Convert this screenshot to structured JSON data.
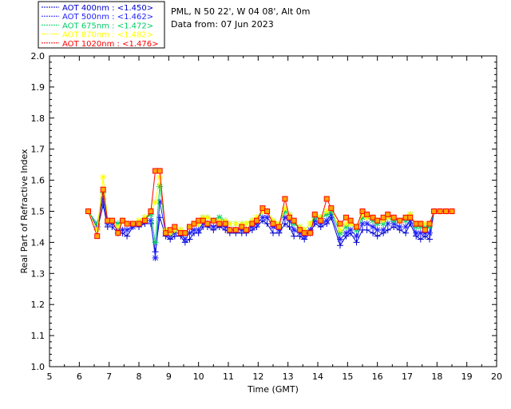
{
  "header": {
    "site_line": "PML, N 50 22', W 04 08', Alt 0m",
    "date_line": "Data from: 07 Jun 2023"
  },
  "chart_data": {
    "type": "line",
    "xlabel": "Time (GMT)",
    "ylabel": "Real Part of Refractive Index",
    "xlim": [
      5,
      20
    ],
    "ylim": [
      1.0,
      2.0
    ],
    "xticks": [
      "5",
      "6",
      "7",
      "8",
      "9",
      "10",
      "11",
      "12",
      "13",
      "14",
      "15",
      "16",
      "17",
      "18",
      "19",
      "20"
    ],
    "yticks": [
      "1.0",
      "1.1",
      "1.2",
      "1.3",
      "1.4",
      "1.5",
      "1.6",
      "1.7",
      "1.8",
      "1.9",
      "2.0"
    ],
    "legend_position": "top-left",
    "grid": false,
    "series": [
      {
        "name": "AOT  400nm : <1.450>",
        "color": "#0000cc",
        "marker": "plus",
        "x": [
          6.3,
          6.6,
          6.8,
          6.95,
          7.1,
          7.3,
          7.45,
          7.6,
          7.8,
          8.0,
          8.2,
          8.4,
          8.55,
          8.7,
          8.9,
          9.05,
          9.2,
          9.4,
          9.55,
          9.7,
          9.85,
          10.0,
          10.15,
          10.3,
          10.5,
          10.7,
          10.9,
          11.05,
          11.25,
          11.45,
          11.6,
          11.8,
          11.95,
          12.15,
          12.3,
          12.5,
          12.7,
          12.9,
          13.05,
          13.2,
          13.4,
          13.55,
          13.75,
          13.9,
          14.1,
          14.3,
          14.45,
          14.75,
          14.95,
          15.1,
          15.3,
          15.5,
          15.65,
          15.85,
          16.0,
          16.2,
          16.35,
          16.55,
          16.75,
          16.95,
          17.1,
          17.3,
          17.45,
          17.6,
          17.75,
          17.9,
          18.1,
          18.3,
          18.5
        ],
        "y": [
          1.5,
          1.44,
          1.52,
          1.45,
          1.45,
          1.43,
          1.43,
          1.42,
          1.45,
          1.45,
          1.46,
          1.46,
          1.37,
          1.48,
          1.42,
          1.41,
          1.42,
          1.42,
          1.4,
          1.41,
          1.43,
          1.43,
          1.45,
          1.45,
          1.44,
          1.45,
          1.44,
          1.43,
          1.43,
          1.43,
          1.43,
          1.44,
          1.45,
          1.47,
          1.46,
          1.43,
          1.43,
          1.46,
          1.45,
          1.42,
          1.42,
          1.41,
          1.43,
          1.46,
          1.45,
          1.46,
          1.48,
          1.39,
          1.42,
          1.43,
          1.4,
          1.44,
          1.44,
          1.43,
          1.42,
          1.43,
          1.44,
          1.45,
          1.44,
          1.43,
          1.46,
          1.42,
          1.41,
          1.42,
          1.41,
          1.5,
          1.5,
          1.5,
          1.5
        ]
      },
      {
        "name": "AOT  500nm : <1.462>",
        "color": "#2222ff",
        "marker": "asterisk",
        "x": [
          6.3,
          6.6,
          6.8,
          6.95,
          7.1,
          7.3,
          7.45,
          7.6,
          7.8,
          8.0,
          8.2,
          8.4,
          8.55,
          8.7,
          8.9,
          9.05,
          9.2,
          9.4,
          9.55,
          9.7,
          9.85,
          10.0,
          10.15,
          10.3,
          10.5,
          10.7,
          10.9,
          11.05,
          11.25,
          11.45,
          11.6,
          11.8,
          11.95,
          12.15,
          12.3,
          12.5,
          12.7,
          12.9,
          13.05,
          13.2,
          13.4,
          13.55,
          13.75,
          13.9,
          14.1,
          14.3,
          14.45,
          14.75,
          14.95,
          15.1,
          15.3,
          15.5,
          15.65,
          15.85,
          16.0,
          16.2,
          16.35,
          16.55,
          16.75,
          16.95,
          17.1,
          17.3,
          17.45,
          17.6,
          17.75,
          17.9,
          18.1,
          18.3,
          18.5
        ],
        "y": [
          1.5,
          1.45,
          1.54,
          1.46,
          1.46,
          1.44,
          1.44,
          1.44,
          1.45,
          1.46,
          1.47,
          1.47,
          1.35,
          1.53,
          1.43,
          1.42,
          1.43,
          1.43,
          1.41,
          1.43,
          1.44,
          1.44,
          1.46,
          1.46,
          1.45,
          1.46,
          1.45,
          1.44,
          1.44,
          1.44,
          1.44,
          1.45,
          1.46,
          1.48,
          1.48,
          1.45,
          1.44,
          1.48,
          1.47,
          1.44,
          1.43,
          1.42,
          1.44,
          1.47,
          1.46,
          1.47,
          1.49,
          1.41,
          1.43,
          1.44,
          1.42,
          1.46,
          1.46,
          1.45,
          1.44,
          1.44,
          1.46,
          1.46,
          1.45,
          1.45,
          1.47,
          1.43,
          1.43,
          1.43,
          1.43,
          1.5,
          1.5,
          1.5,
          1.5
        ]
      },
      {
        "name": "AOT  675nm : <1.472>",
        "color": "#00cc66",
        "marker": "asterisk",
        "x": [
          6.3,
          6.6,
          6.8,
          6.95,
          7.1,
          7.3,
          7.45,
          7.6,
          7.8,
          8.0,
          8.2,
          8.4,
          8.55,
          8.7,
          8.9,
          9.05,
          9.2,
          9.4,
          9.55,
          9.7,
          9.85,
          10.0,
          10.15,
          10.3,
          10.5,
          10.7,
          10.9,
          11.05,
          11.25,
          11.45,
          11.6,
          11.8,
          11.95,
          12.15,
          12.3,
          12.5,
          12.7,
          12.9,
          13.05,
          13.2,
          13.4,
          13.55,
          13.75,
          13.9,
          14.1,
          14.3,
          14.45,
          14.75,
          14.95,
          15.1,
          15.3,
          15.5,
          15.65,
          15.85,
          16.0,
          16.2,
          16.35,
          16.55,
          16.75,
          16.95,
          17.1,
          17.3,
          17.45,
          17.6,
          17.75,
          17.9,
          18.1,
          18.3,
          18.5
        ],
        "y": [
          1.5,
          1.46,
          1.56,
          1.47,
          1.47,
          1.46,
          1.47,
          1.46,
          1.46,
          1.47,
          1.48,
          1.49,
          1.4,
          1.58,
          1.44,
          1.43,
          1.44,
          1.44,
          1.43,
          1.45,
          1.46,
          1.46,
          1.48,
          1.48,
          1.47,
          1.48,
          1.47,
          1.46,
          1.46,
          1.46,
          1.46,
          1.47,
          1.47,
          1.5,
          1.5,
          1.47,
          1.46,
          1.5,
          1.49,
          1.46,
          1.45,
          1.44,
          1.46,
          1.48,
          1.48,
          1.49,
          1.5,
          1.43,
          1.45,
          1.46,
          1.44,
          1.48,
          1.48,
          1.47,
          1.46,
          1.46,
          1.48,
          1.47,
          1.47,
          1.47,
          1.49,
          1.45,
          1.45,
          1.45,
          1.45,
          1.5,
          1.5,
          1.5,
          1.5
        ]
      },
      {
        "name": "AOT  870nm : <1.482>",
        "color": "#ffff00",
        "marker": "asterisk",
        "x": [
          6.3,
          6.6,
          6.8,
          6.95,
          7.1,
          7.3,
          7.45,
          7.6,
          7.8,
          8.0,
          8.2,
          8.4,
          8.55,
          8.7,
          8.9,
          9.05,
          9.2,
          9.4,
          9.55,
          9.7,
          9.85,
          10.0,
          10.15,
          10.3,
          10.5,
          10.7,
          10.9,
          11.05,
          11.25,
          11.45,
          11.6,
          11.8,
          11.95,
          12.15,
          12.3,
          12.5,
          12.7,
          12.9,
          13.05,
          13.2,
          13.4,
          13.55,
          13.75,
          13.9,
          14.1,
          14.3,
          14.45,
          14.75,
          14.95,
          15.1,
          15.3,
          15.5,
          15.65,
          15.85,
          16.0,
          16.2,
          16.35,
          16.55,
          16.75,
          16.95,
          17.1,
          17.3,
          17.45,
          17.6,
          17.75,
          17.9,
          18.1,
          18.3,
          18.5
        ],
        "y": [
          1.5,
          1.44,
          1.61,
          1.47,
          1.47,
          1.45,
          1.47,
          1.46,
          1.46,
          1.47,
          1.48,
          1.5,
          1.53,
          1.61,
          1.44,
          1.43,
          1.44,
          1.44,
          1.43,
          1.45,
          1.46,
          1.46,
          1.48,
          1.48,
          1.47,
          1.47,
          1.47,
          1.46,
          1.46,
          1.46,
          1.46,
          1.47,
          1.48,
          1.5,
          1.5,
          1.47,
          1.46,
          1.51,
          1.49,
          1.47,
          1.45,
          1.44,
          1.46,
          1.49,
          1.48,
          1.5,
          1.51,
          1.44,
          1.46,
          1.46,
          1.45,
          1.49,
          1.48,
          1.48,
          1.47,
          1.47,
          1.48,
          1.48,
          1.47,
          1.48,
          1.49,
          1.46,
          1.46,
          1.46,
          1.46,
          1.5,
          1.5,
          1.5,
          1.5
        ]
      },
      {
        "name": "AOT 1020nm : <1.476>",
        "color": "#ff0000",
        "marker": "square",
        "x": [
          6.3,
          6.6,
          6.8,
          6.95,
          7.1,
          7.3,
          7.45,
          7.6,
          7.8,
          8.0,
          8.2,
          8.4,
          8.55,
          8.7,
          8.9,
          9.05,
          9.2,
          9.4,
          9.55,
          9.7,
          9.85,
          10.0,
          10.15,
          10.3,
          10.5,
          10.7,
          10.9,
          11.05,
          11.25,
          11.45,
          11.6,
          11.8,
          11.95,
          12.15,
          12.3,
          12.5,
          12.7,
          12.9,
          13.05,
          13.2,
          13.4,
          13.55,
          13.75,
          13.9,
          14.1,
          14.3,
          14.45,
          14.75,
          14.95,
          15.1,
          15.3,
          15.5,
          15.65,
          15.85,
          16.0,
          16.2,
          16.35,
          16.55,
          16.75,
          16.95,
          17.1,
          17.3,
          17.45,
          17.6,
          17.75,
          17.9,
          18.1,
          18.3,
          18.5
        ],
        "y": [
          1.5,
          1.42,
          1.57,
          1.47,
          1.47,
          1.43,
          1.47,
          1.46,
          1.46,
          1.46,
          1.47,
          1.5,
          1.63,
          1.63,
          1.43,
          1.44,
          1.45,
          1.43,
          1.43,
          1.45,
          1.46,
          1.47,
          1.47,
          1.46,
          1.47,
          1.46,
          1.46,
          1.44,
          1.44,
          1.45,
          1.44,
          1.46,
          1.47,
          1.51,
          1.5,
          1.46,
          1.45,
          1.54,
          1.48,
          1.47,
          1.44,
          1.43,
          1.43,
          1.49,
          1.47,
          1.54,
          1.51,
          1.46,
          1.48,
          1.47,
          1.45,
          1.5,
          1.49,
          1.48,
          1.47,
          1.48,
          1.49,
          1.48,
          1.47,
          1.48,
          1.48,
          1.46,
          1.46,
          1.44,
          1.46,
          1.5,
          1.5,
          1.5,
          1.5
        ]
      }
    ]
  }
}
